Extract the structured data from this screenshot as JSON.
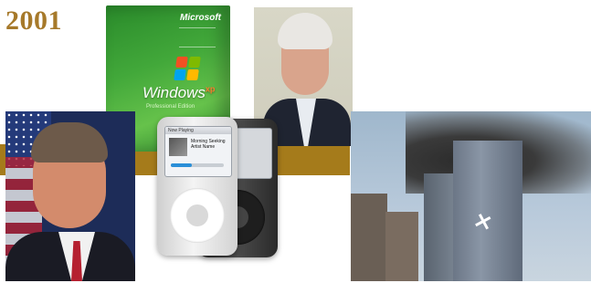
{
  "year": "2001",
  "colors": {
    "year_text": "#a6792a",
    "band": "#a57b1b"
  },
  "images": {
    "winxp": {
      "maker": "Microsoft",
      "brand": "Windows",
      "brand_suffix": "xp",
      "edition": "Professional Edition"
    },
    "ipod": {
      "header": "Now Playing",
      "track_line1": "Morning Seeking",
      "track_line2": "Artist Name",
      "progress": 0.4
    }
  }
}
